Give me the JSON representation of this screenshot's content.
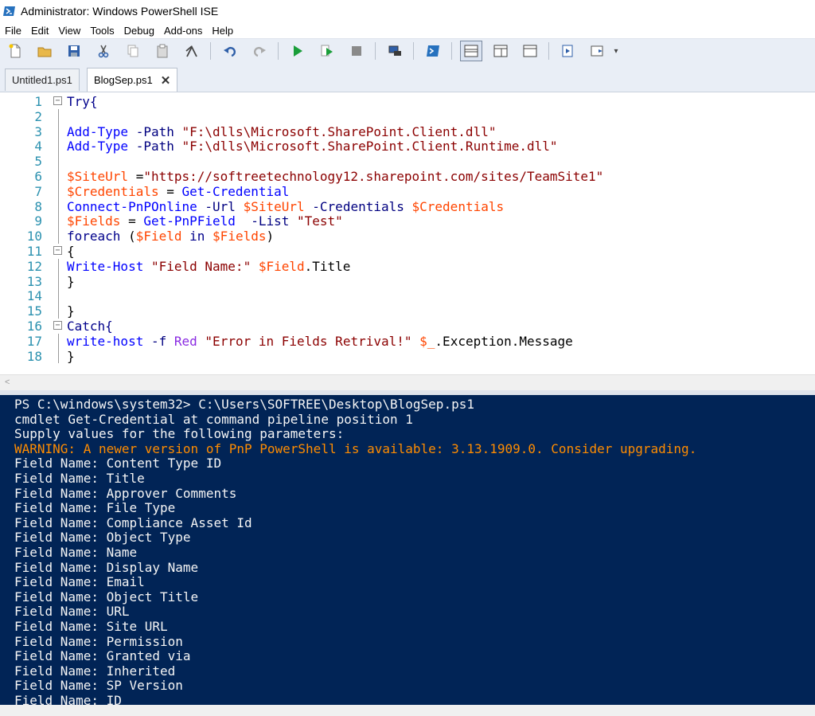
{
  "window": {
    "title": "Administrator: Windows PowerShell ISE"
  },
  "menu": [
    "File",
    "Edit",
    "View",
    "Tools",
    "Debug",
    "Add-ons",
    "Help"
  ],
  "toolbar": {
    "icons": [
      "new-icon",
      "open-icon",
      "save-icon",
      "cut-icon",
      "copy-icon",
      "paste-icon",
      "clear-icon",
      "undo-icon",
      "redo-icon",
      "run-icon",
      "run-selection-icon",
      "stop-icon",
      "remote-powershell-icon",
      "powershell-console-icon",
      "script-pane-top-icon",
      "script-pane-right-icon",
      "script-pane-maximized-icon",
      "show-command-window-icon",
      "show-command-addon-icon",
      "more-icon"
    ]
  },
  "tabs": [
    {
      "label": "Untitled1.ps1",
      "active": false
    },
    {
      "label": "BlogSep.ps1",
      "active": true,
      "close": "✕"
    }
  ],
  "editor": {
    "line_numbers": [
      "1",
      "2",
      "3",
      "4",
      "5",
      "6",
      "7",
      "8",
      "9",
      "10",
      "11",
      "12",
      "13",
      "14",
      "15",
      "16",
      "17",
      "18"
    ],
    "lines": [
      [
        [
          "kw",
          "Try{"
        ]
      ],
      [],
      [
        [
          "cmd",
          "Add-Type"
        ],
        [
          "plain",
          " "
        ],
        [
          "par",
          "-Path"
        ],
        [
          "plain",
          " "
        ],
        [
          "str",
          "\"F:\\dlls\\Microsoft.SharePoint.Client.dll\""
        ]
      ],
      [
        [
          "cmd",
          "Add-Type"
        ],
        [
          "plain",
          " "
        ],
        [
          "par",
          "-Path"
        ],
        [
          "plain",
          " "
        ],
        [
          "str",
          "\"F:\\dlls\\Microsoft.SharePoint.Client.Runtime.dll\""
        ]
      ],
      [],
      [
        [
          "var",
          "$SiteUrl"
        ],
        [
          "plain",
          " ="
        ],
        [
          "str",
          "\"https://softreetechnology12.sharepoint.com/sites/TeamSite1\""
        ]
      ],
      [
        [
          "var",
          "$Credentials"
        ],
        [
          "plain",
          " = "
        ],
        [
          "cmd",
          "Get-Credential"
        ]
      ],
      [
        [
          "cmd",
          "Connect-PnPOnline"
        ],
        [
          "plain",
          " "
        ],
        [
          "par",
          "-Url"
        ],
        [
          "plain",
          " "
        ],
        [
          "var",
          "$SiteUrl"
        ],
        [
          "plain",
          " "
        ],
        [
          "par",
          "-Credentials"
        ],
        [
          "plain",
          " "
        ],
        [
          "var",
          "$Credentials"
        ]
      ],
      [
        [
          "var",
          "$Fields"
        ],
        [
          "plain",
          " = "
        ],
        [
          "cmd",
          "Get-PnPField"
        ],
        [
          "plain",
          "  "
        ],
        [
          "par",
          "-List"
        ],
        [
          "plain",
          " "
        ],
        [
          "str",
          "\"Test\""
        ]
      ],
      [
        [
          "kw",
          "foreach"
        ],
        [
          "plain",
          " ("
        ],
        [
          "var",
          "$Field"
        ],
        [
          "plain",
          " "
        ],
        [
          "kw",
          "in"
        ],
        [
          "plain",
          " "
        ],
        [
          "var",
          "$Fields"
        ],
        [
          "plain",
          ")"
        ]
      ],
      [
        [
          "plain",
          "{"
        ]
      ],
      [
        [
          "cmd",
          "Write-Host"
        ],
        [
          "plain",
          " "
        ],
        [
          "str",
          "\"Field Name:\""
        ],
        [
          "plain",
          " "
        ],
        [
          "var",
          "$Field"
        ],
        [
          "plain",
          ".Title"
        ]
      ],
      [
        [
          "plain",
          "}"
        ]
      ],
      [],
      [
        [
          "plain",
          "}"
        ]
      ],
      [
        [
          "kw",
          "Catch{"
        ]
      ],
      [
        [
          "cmd",
          "write-host"
        ],
        [
          "plain",
          " "
        ],
        [
          "par",
          "-f"
        ],
        [
          "plain",
          " "
        ],
        [
          "typ",
          "Red"
        ],
        [
          "plain",
          " "
        ],
        [
          "str",
          "\"Error in Fields Retrival!\""
        ],
        [
          "plain",
          " "
        ],
        [
          "var",
          "$_"
        ],
        [
          "plain",
          ".Exception.Message"
        ]
      ],
      [
        [
          "plain",
          "}"
        ]
      ]
    ]
  },
  "console": {
    "lines": [
      "PS C:\\windows\\system32> C:\\Users\\SOFTREE\\Desktop\\BlogSep.ps1",
      "cmdlet Get-Credential at command pipeline position 1",
      "Supply values for the following parameters:",
      "WARNING: A newer version of PnP PowerShell is available: 3.13.1909.0. Consider upgrading.",
      "Field Name: Content Type ID",
      "Field Name: Title",
      "Field Name: Approver Comments",
      "Field Name: File Type",
      "Field Name: Compliance Asset Id",
      "Field Name: Object Type",
      "Field Name: Name",
      "Field Name: Display Name",
      "Field Name: Email",
      "Field Name: Object Title",
      "Field Name: URL",
      "Field Name: Site URL",
      "Field Name: Permission",
      "Field Name: Granted via",
      "Field Name: Inherited",
      "Field Name: SP Version",
      "Field Name: ID"
    ],
    "warning_index": 3
  },
  "colors": {
    "console_bg": "#012456",
    "warning": "#ff8c00"
  }
}
